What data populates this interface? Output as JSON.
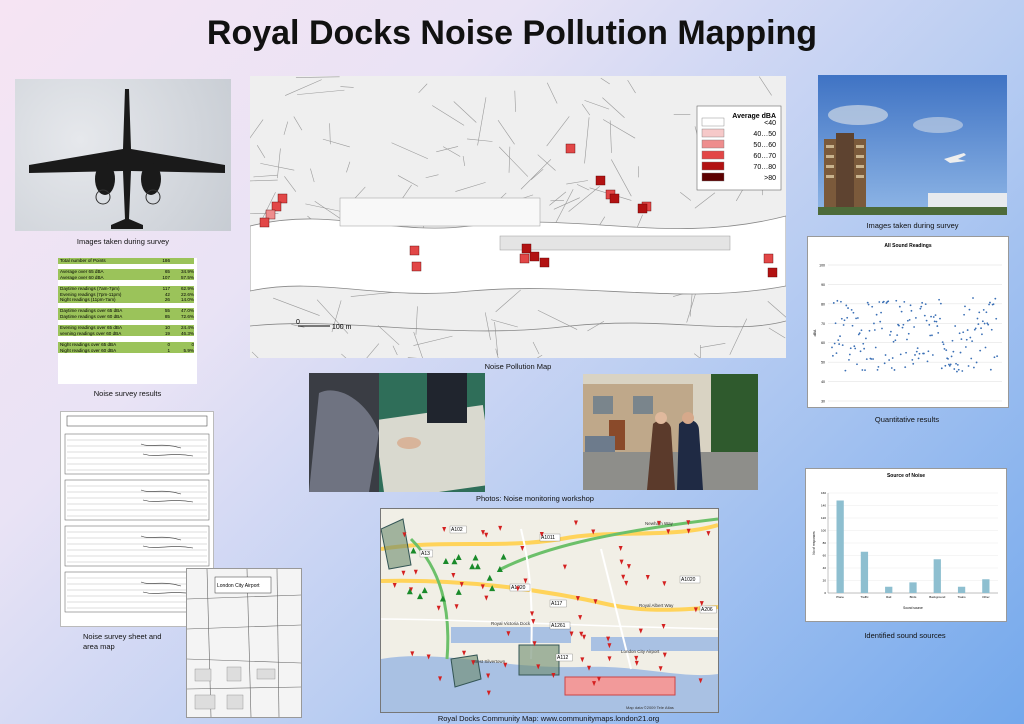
{
  "poster": {
    "title": "Royal Docks Noise Pollution Mapping"
  },
  "captions": {
    "images_left": "Images taken during survey",
    "images_right": "Images taken during survey",
    "survey_results": "Noise survey results",
    "noise_map": "Noise Pollution Map",
    "workshop": "Photos: Noise monitoring workshop",
    "quantitative": "Quantitative results",
    "survey_sheet_line1": "Noise survey sheet and",
    "survey_sheet_line2": "area map",
    "sources": "Identified sound sources",
    "community_map": "Royal Docks Community Map: www.communitymaps.london21.org"
  },
  "stats_table": {
    "rows": [
      {
        "label": "Total number of Points",
        "count": "186",
        "pct": ""
      },
      null,
      {
        "label": "Average over 65 dBA",
        "count": "65",
        "pct": "34.9%"
      },
      {
        "label": "Average over 60 dBA",
        "count": "107",
        "pct": "57.5%"
      },
      null,
      {
        "label": "Daytime readings (7am-7pm)",
        "count": "117",
        "pct": "62.9%"
      },
      {
        "label": "Evening readings (7pm-11pm)",
        "count": "42",
        "pct": "22.6%"
      },
      {
        "label": "Night readings (11pm-7am)",
        "count": "26",
        "pct": "14.0%"
      },
      null,
      {
        "label": "Daytime readings over 65 dBA",
        "count": "55",
        "pct": "47.0%"
      },
      {
        "label": "Daytime readings over 60 dBA",
        "count": "85",
        "pct": "72.6%"
      },
      null,
      {
        "label": "Evening readings over 65 dBA",
        "count": "10",
        "pct": "24.4%"
      },
      {
        "label": "vevning readings over 60 dBA",
        "count": "19",
        "pct": "46.3%"
      },
      null,
      {
        "label": "Night readings over 65 dBA",
        "count": "0",
        "pct": "0"
      },
      {
        "label": "Night readings over 60 dBA",
        "count": "1",
        "pct": "5.9%"
      }
    ]
  },
  "noise_map": {
    "legend_title": "Average dBA",
    "legend": [
      {
        "label": "<40",
        "color": "#ffffff"
      },
      {
        "label": "40…50",
        "color": "#f6c9c9"
      },
      {
        "label": "50…60",
        "color": "#ee8d8d"
      },
      {
        "label": "60…70",
        "color": "#e24747"
      },
      {
        "label": "70…80",
        "color": "#b21212"
      },
      {
        "label": ">80",
        "color": "#5c0000"
      }
    ],
    "scale_label": "100 m",
    "scale_zero": "0"
  },
  "community_map": {
    "road_labels": [
      "A102",
      "A13",
      "A1020",
      "A1011",
      "A117",
      "A112",
      "A1261",
      "A206",
      "A1020"
    ],
    "place_labels": [
      "Royal Albert Way",
      "Newham Way",
      "London City Airport",
      "West Silvertown",
      "Royal Victoria Dock"
    ],
    "attribution": "Map data ©2009 Tele Atlas"
  },
  "chart_data": [
    {
      "type": "scatter",
      "title": "All Sound Readings",
      "ylabel": "dBA",
      "ylim": [
        30,
        100
      ],
      "grid": true,
      "y_tick_labels": [
        "100",
        "90",
        "80",
        "70",
        "60",
        "50",
        "40",
        "30"
      ]
    },
    {
      "type": "bar",
      "title": "Source of Noise",
      "xlabel": "Sound source",
      "ylabel": "No of responses",
      "categories": [
        "Plane",
        "Traffic",
        "Rail",
        "Birds",
        "Background",
        "Trains",
        "Other"
      ],
      "values": [
        148,
        66,
        10,
        17,
        54,
        10,
        22
      ],
      "ylim": [
        0,
        160
      ],
      "y_ticks": [
        "160",
        "140",
        "120",
        "100",
        "80",
        "60",
        "40",
        "20",
        "0"
      ],
      "color": "#8ebfd0"
    }
  ],
  "colors": {
    "accent": "#c72323",
    "chart_point": "#3a6fb5"
  }
}
